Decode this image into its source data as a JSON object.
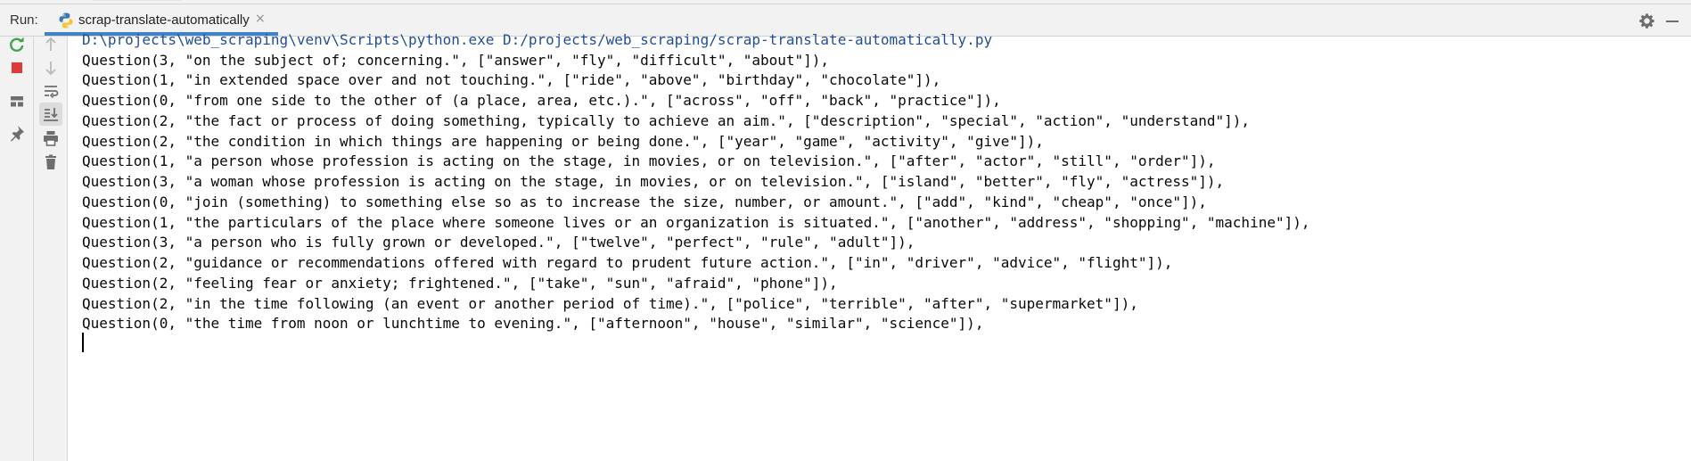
{
  "header": {
    "run_label": "Run:",
    "tab": {
      "label": "scrap-translate-automatically",
      "close_glyph": "×",
      "icon": "python-file-icon"
    },
    "right_icons": [
      "gear-icon",
      "minimize-icon"
    ]
  },
  "toolbar_left": [
    "rerun-icon",
    "stop-icon",
    "layout-icon",
    "pin-icon"
  ],
  "toolbar_mid": [
    "arrow-up-icon",
    "arrow-down-icon",
    "soft-wrap-icon",
    "scroll-to-end-icon",
    "print-icon",
    "trash-icon"
  ],
  "console": {
    "command": "D:\\projects\\web_scraping\\venv\\Scripts\\python.exe D:/projects/web_scraping/scrap-translate-automatically.py",
    "lines": [
      "Question(3, \"on the subject of; concerning.\", [\"answer\", \"fly\", \"difficult\", \"about\"]),",
      "Question(1, \"in extended space over and not touching.\", [\"ride\", \"above\", \"birthday\", \"chocolate\"]),",
      "Question(0, \"from one side to the other of (a place, area, etc.).\", [\"across\", \"off\", \"back\", \"practice\"]),",
      "Question(2, \"the fact or process of doing something, typically to achieve an aim.\", [\"description\", \"special\", \"action\", \"understand\"]),",
      "Question(2, \"the condition in which things are happening or being done.\", [\"year\", \"game\", \"activity\", \"give\"]),",
      "Question(1, \"a person whose profession is acting on the stage, in movies, or on television.\", [\"after\", \"actor\", \"still\", \"order\"]),",
      "Question(3, \"a woman whose profession is acting on the stage, in movies, or on television.\", [\"island\", \"better\", \"fly\", \"actress\"]),",
      "Question(0, \"join (something) to something else so as to increase the size, number, or amount.\", [\"add\", \"kind\", \"cheap\", \"once\"]),",
      "Question(1, \"the particulars of the place where someone lives or an organization is situated.\", [\"another\", \"address\", \"shopping\", \"machine\"]),",
      "Question(3, \"a person who is fully grown or developed.\", [\"twelve\", \"perfect\", \"rule\", \"adult\"]),",
      "Question(2, \"guidance or recommendations offered with regard to prudent future action.\", [\"in\", \"driver\", \"advice\", \"flight\"]),",
      "Question(2, \"feeling fear or anxiety; frightened.\", [\"take\", \"sun\", \"afraid\", \"phone\"]),",
      "Question(2, \"in the time following (an event or another period of time).\", [\"police\", \"terrible\", \"after\", \"supermarket\"]),",
      "Question(0, \"the time from noon or lunchtime to evening.\", [\"afternoon\", \"house\", \"similar\", \"science\"]),"
    ]
  },
  "colors": {
    "accent": "#4083c9",
    "command_text": "#1f4e96",
    "rerun": "#3fa34d",
    "stop": "#db3b3b"
  }
}
